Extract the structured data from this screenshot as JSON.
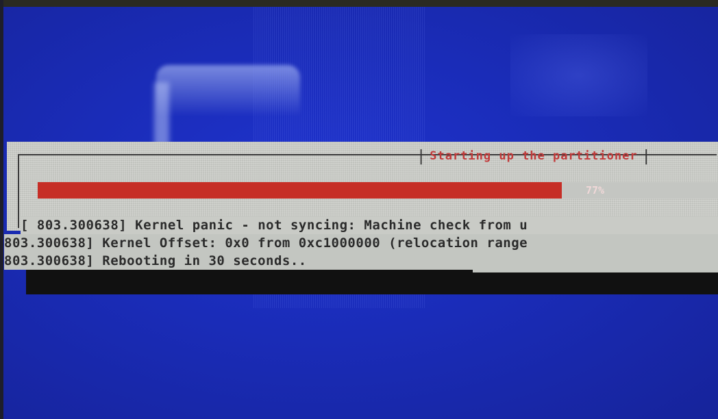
{
  "dialog": {
    "title": "Starting up the partitioner",
    "progress_percent": 77,
    "progress_label": "77%"
  },
  "console": {
    "lines": [
      "[   803.300638] Kernel panic - not syncing: Machine check from u",
      "803.300638] Kernel Offset: 0x0 from 0xc1000000 (relocation range",
      "803.300638] Rebooting in 30 seconds.."
    ]
  },
  "colors": {
    "screen_background": "#1a2cb8",
    "dialog_background": "#c9cbc6",
    "progress_fill": "#c62e26",
    "title_text": "#c23a3a",
    "console_text": "#2b2b2b"
  }
}
